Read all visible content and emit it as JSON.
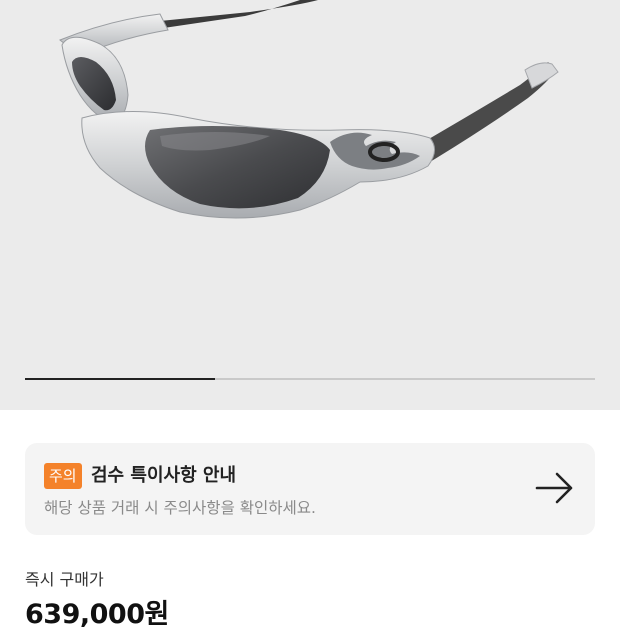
{
  "product_image": {
    "icon": "oakley-sunglasses-image",
    "carousel_progress": 0.333
  },
  "notice": {
    "badge": "주의",
    "title": "검수 특이사항 안내",
    "description": "해당 상품 거래 시 주의사항을 확인하세요.",
    "arrow_icon": "arrow-right-icon",
    "badge_color": "#f4822a"
  },
  "purchase": {
    "label": "즉시 구매가",
    "price": "639,000원"
  }
}
